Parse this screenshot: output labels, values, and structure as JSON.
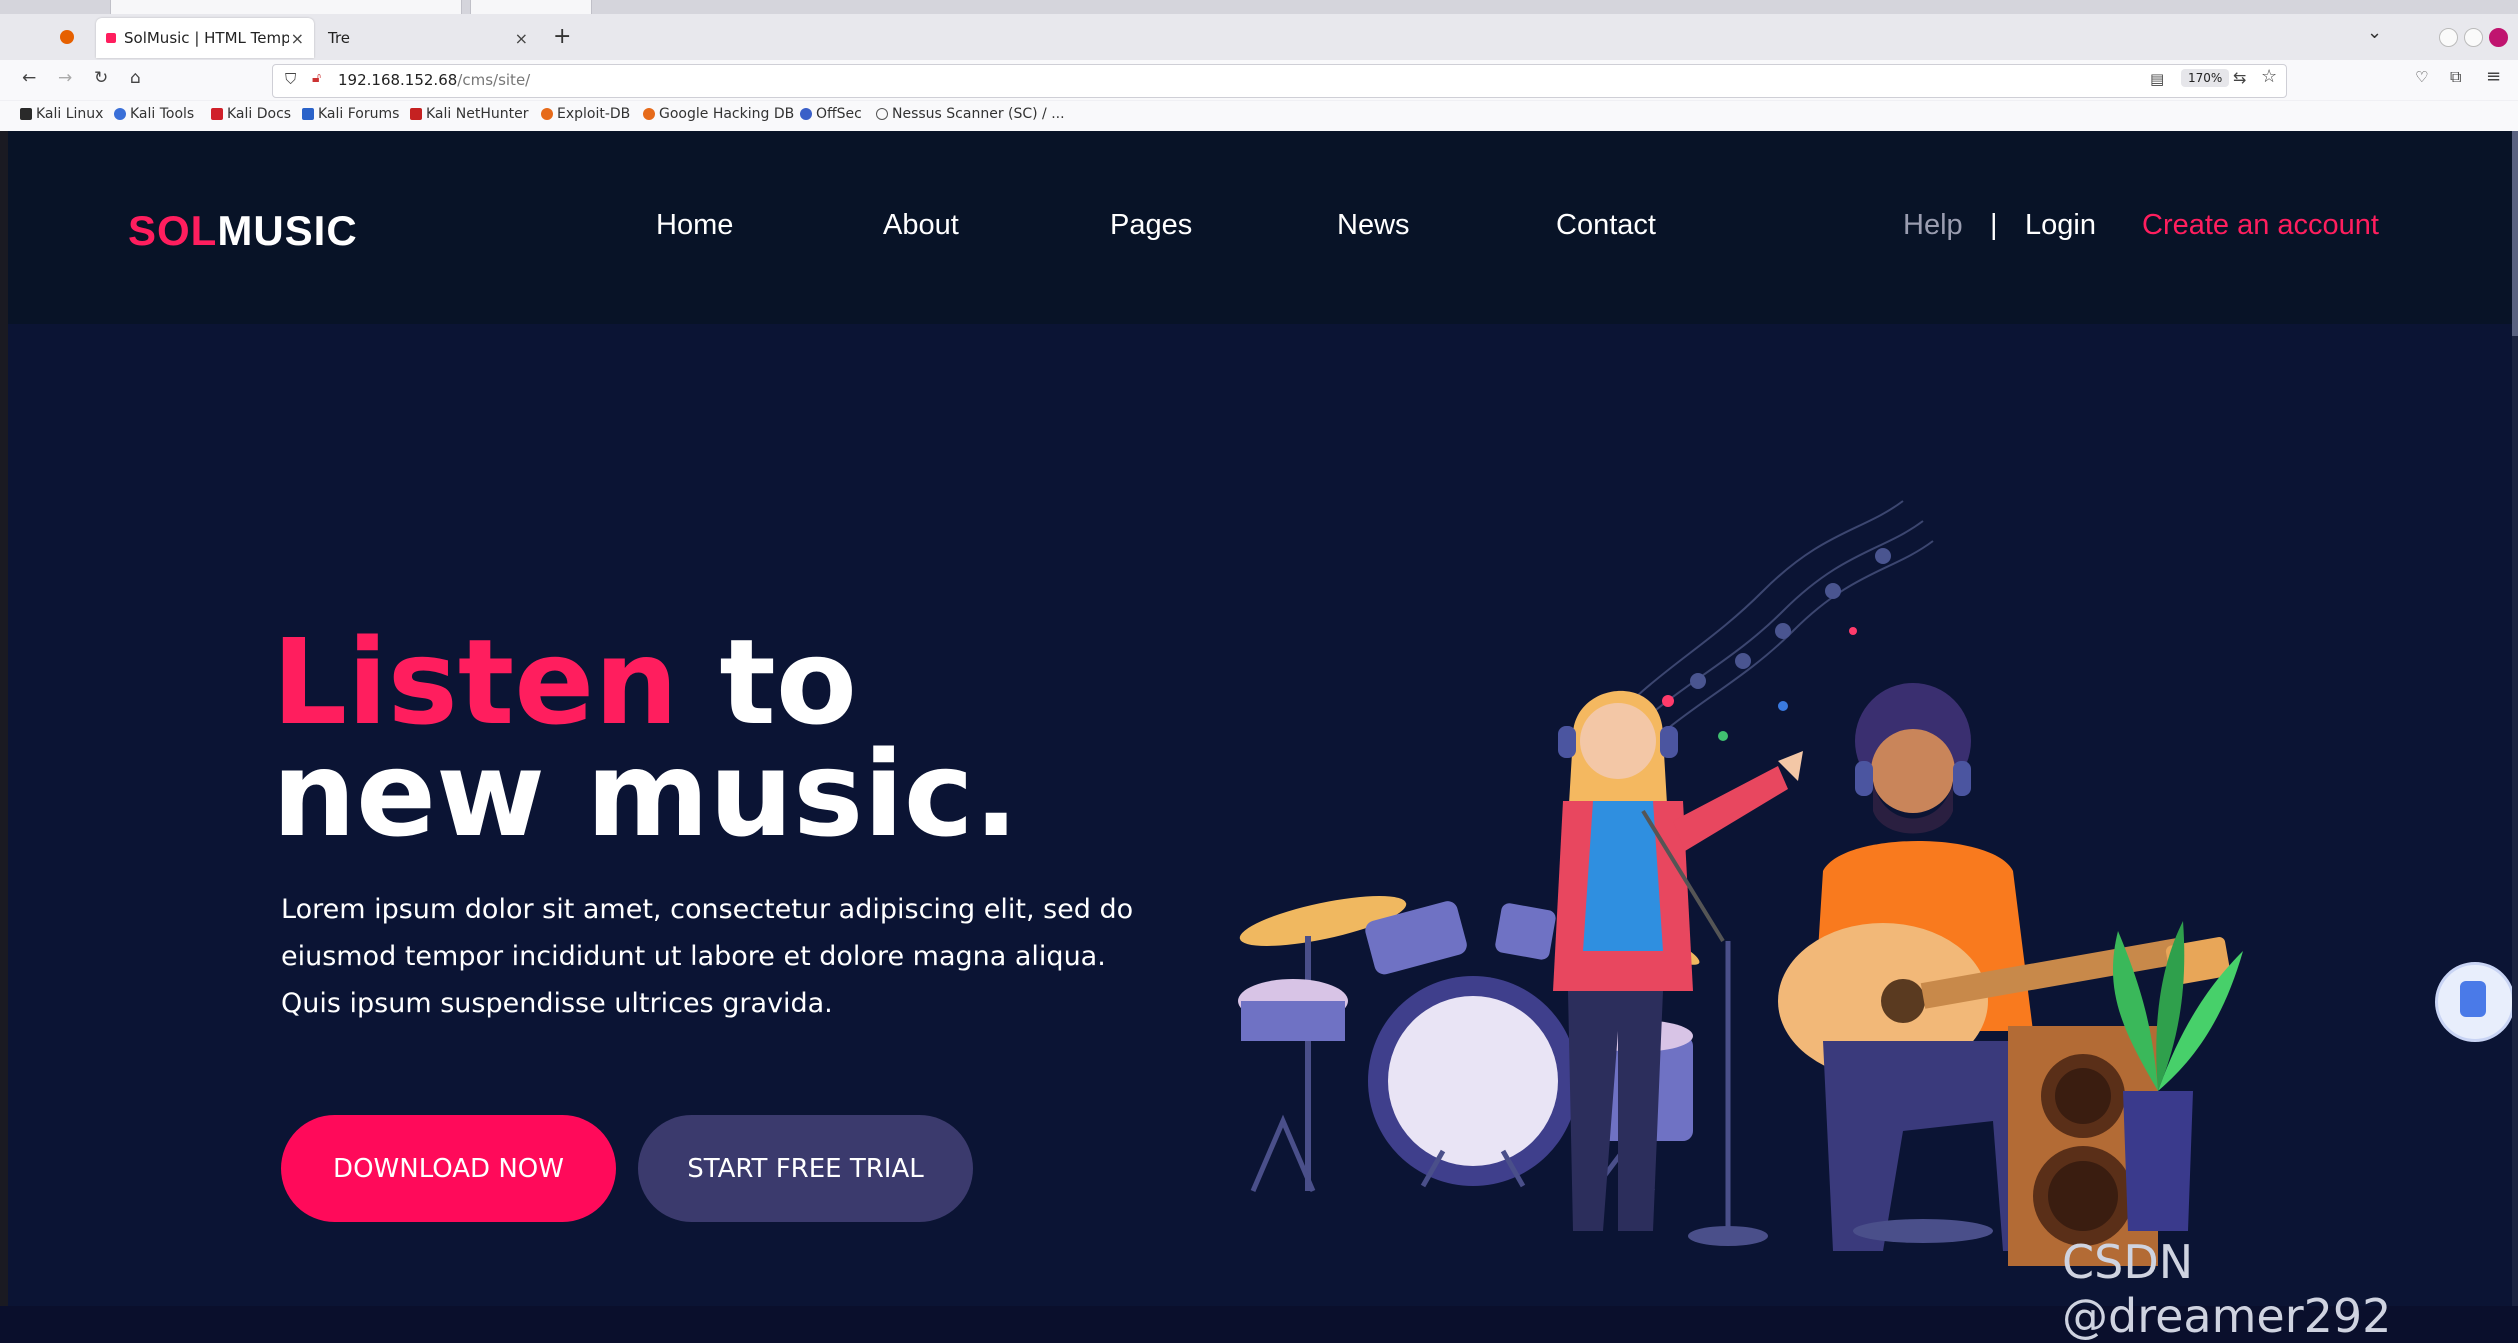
{
  "browser": {
    "tabs": [
      {
        "title": "SolMusic | HTML Templat",
        "active": true
      },
      {
        "title": "Tre",
        "active": false
      }
    ],
    "url_host": "192.168.152.68",
    "url_path": "/cms/site/",
    "zoom": "170%",
    "bookmarks": [
      "Kali Linux",
      "Kali Tools",
      "Kali Docs",
      "Kali Forums",
      "Kali NetHunter",
      "Exploit-DB",
      "Google Hacking DB",
      "OffSec",
      "Nessus Scanner (SC) / ..."
    ]
  },
  "site": {
    "logo_accent": "SOL",
    "logo_rest": "MUSIC",
    "nav": [
      "Home",
      "About",
      "Pages",
      "News",
      "Contact"
    ],
    "help": "Help",
    "separator": "|",
    "login": "Login",
    "create_account": "Create an account"
  },
  "hero": {
    "title_accent": "Listen",
    "title_rest_1": "to",
    "title_line_2": "new music.",
    "paragraph": "Lorem ipsum dolor sit amet, consectetur adipiscing elit, sed do eiusmod tempor incididunt ut labore et dolore magna aliqua. Quis ipsum suspendisse ultrices gravida.",
    "btn_primary": "DOWNLOAD NOW",
    "btn_secondary": "START FREE TRIAL"
  },
  "watermark": "CSDN @dreamer292",
  "colors": {
    "accent": "#ff1e5e",
    "page_bg": "#0b1434",
    "header_bg": "#081327",
    "secondary_btn": "#3b3a6d"
  }
}
